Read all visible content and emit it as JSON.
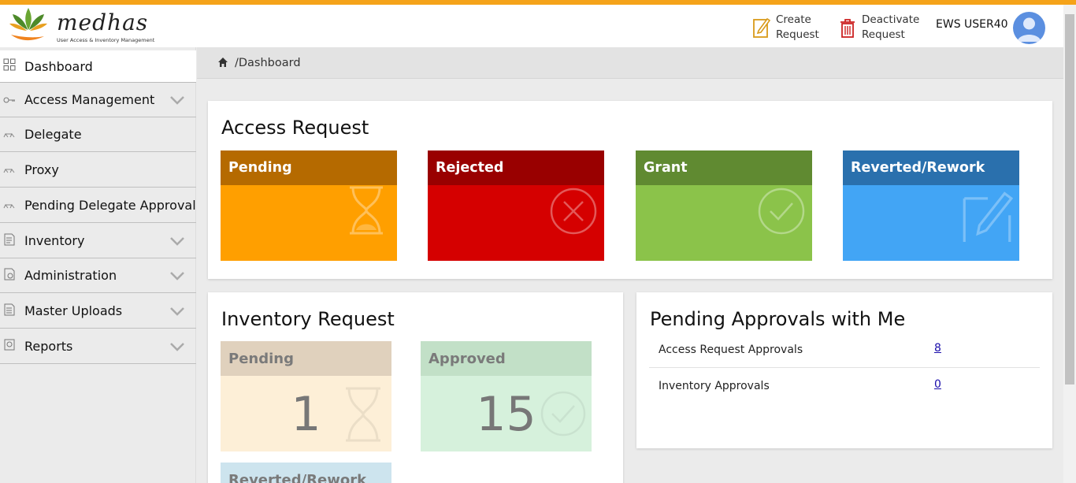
{
  "app": {
    "logo_text": "medhas",
    "logo_subtitle": "User Access & Inventory Management"
  },
  "header": {
    "create_request": [
      "Create",
      "Request"
    ],
    "deactivate_request": [
      "Deactivate",
      "Request"
    ],
    "user_name": "EWS USER40"
  },
  "sidebar": {
    "items": [
      {
        "label": "Dashboard",
        "icon": "grid-icon",
        "expandable": false,
        "active": true
      },
      {
        "label": "Access Management",
        "icon": "key-icon",
        "expandable": true
      },
      {
        "label": "Delegate",
        "icon": "people-icon",
        "expandable": false
      },
      {
        "label": "Proxy",
        "icon": "people-icon",
        "expandable": false
      },
      {
        "label": "Pending Delegate Approval",
        "icon": "people-icon",
        "expandable": false
      },
      {
        "label": "Inventory",
        "icon": "document-icon",
        "expandable": true
      },
      {
        "label": "Administration",
        "icon": "admin-icon",
        "expandable": true
      },
      {
        "label": "Master Uploads",
        "icon": "upload-doc-icon",
        "expandable": true
      },
      {
        "label": "Reports",
        "icon": "report-icon",
        "expandable": true
      }
    ]
  },
  "breadcrumb": {
    "text": "/Dashboard"
  },
  "access_request": {
    "title": "Access Request",
    "cards": [
      {
        "label": "Pending",
        "icon": "hourglass-icon",
        "head_color": "#b56a00",
        "body_color": "#ff9f00"
      },
      {
        "label": "Rejected",
        "icon": "x-circle-icon",
        "head_color": "#990000",
        "body_color": "#d50000"
      },
      {
        "label": "Grant",
        "icon": "check-circle-icon",
        "head_color": "#608a31",
        "body_color": "#8bc34a"
      },
      {
        "label": "Reverted/Rework",
        "icon": "edit-icon",
        "head_color": "#2a70ad",
        "body_color": "#42a5f5"
      }
    ]
  },
  "inventory_request": {
    "title": "Inventory Request",
    "cards": [
      {
        "label": "Pending",
        "count": "1",
        "icon": "hourglass-icon",
        "head_color": "#e0d1bd",
        "body_color": "#fdefd7"
      },
      {
        "label": "Approved",
        "count": "15",
        "icon": "check-circle-icon",
        "head_color": "#c2e0c7",
        "body_color": "#d6f1dc"
      },
      {
        "label": "Reverted/Rework",
        "head_color": "#cde4ee"
      }
    ]
  },
  "pending_approvals": {
    "title": "Pending Approvals with Me",
    "rows": [
      {
        "label": "Access Request Approvals",
        "count": "8"
      },
      {
        "label": "Inventory Approvals",
        "count": "0"
      }
    ]
  }
}
